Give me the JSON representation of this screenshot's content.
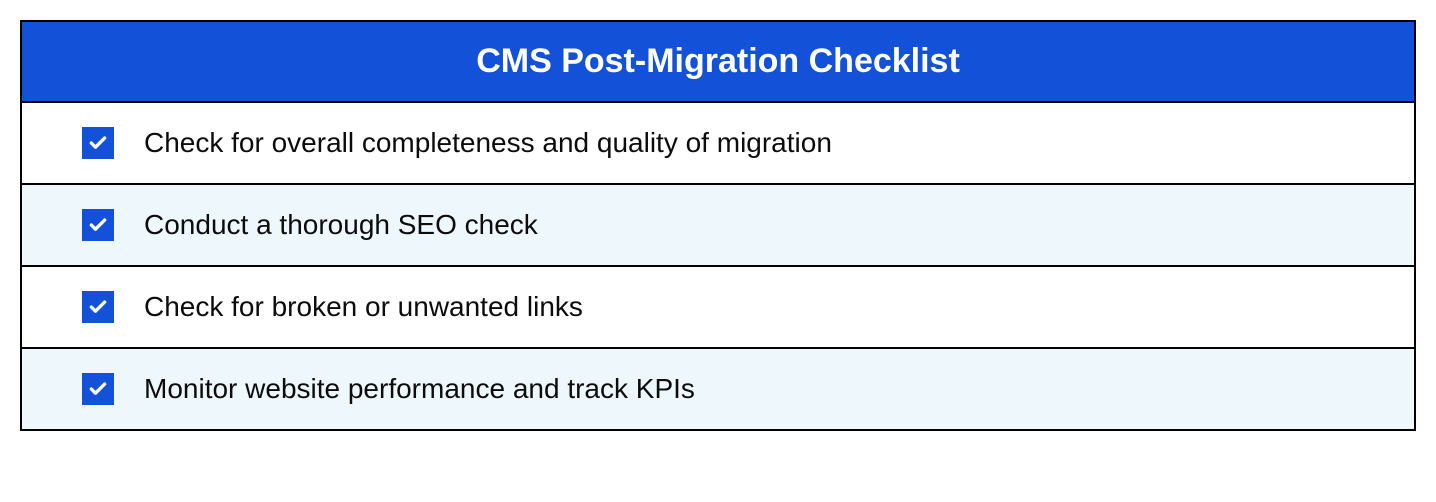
{
  "checklist": {
    "title": "CMS Post-Migration Checklist",
    "items": [
      {
        "label": "Check for overall completeness and quality of migration",
        "checked": true
      },
      {
        "label": "Conduct a thorough SEO check",
        "checked": true
      },
      {
        "label": "Check for broken or unwanted links",
        "checked": true
      },
      {
        "label": "Monitor website performance and track KPIs",
        "checked": true
      }
    ]
  }
}
